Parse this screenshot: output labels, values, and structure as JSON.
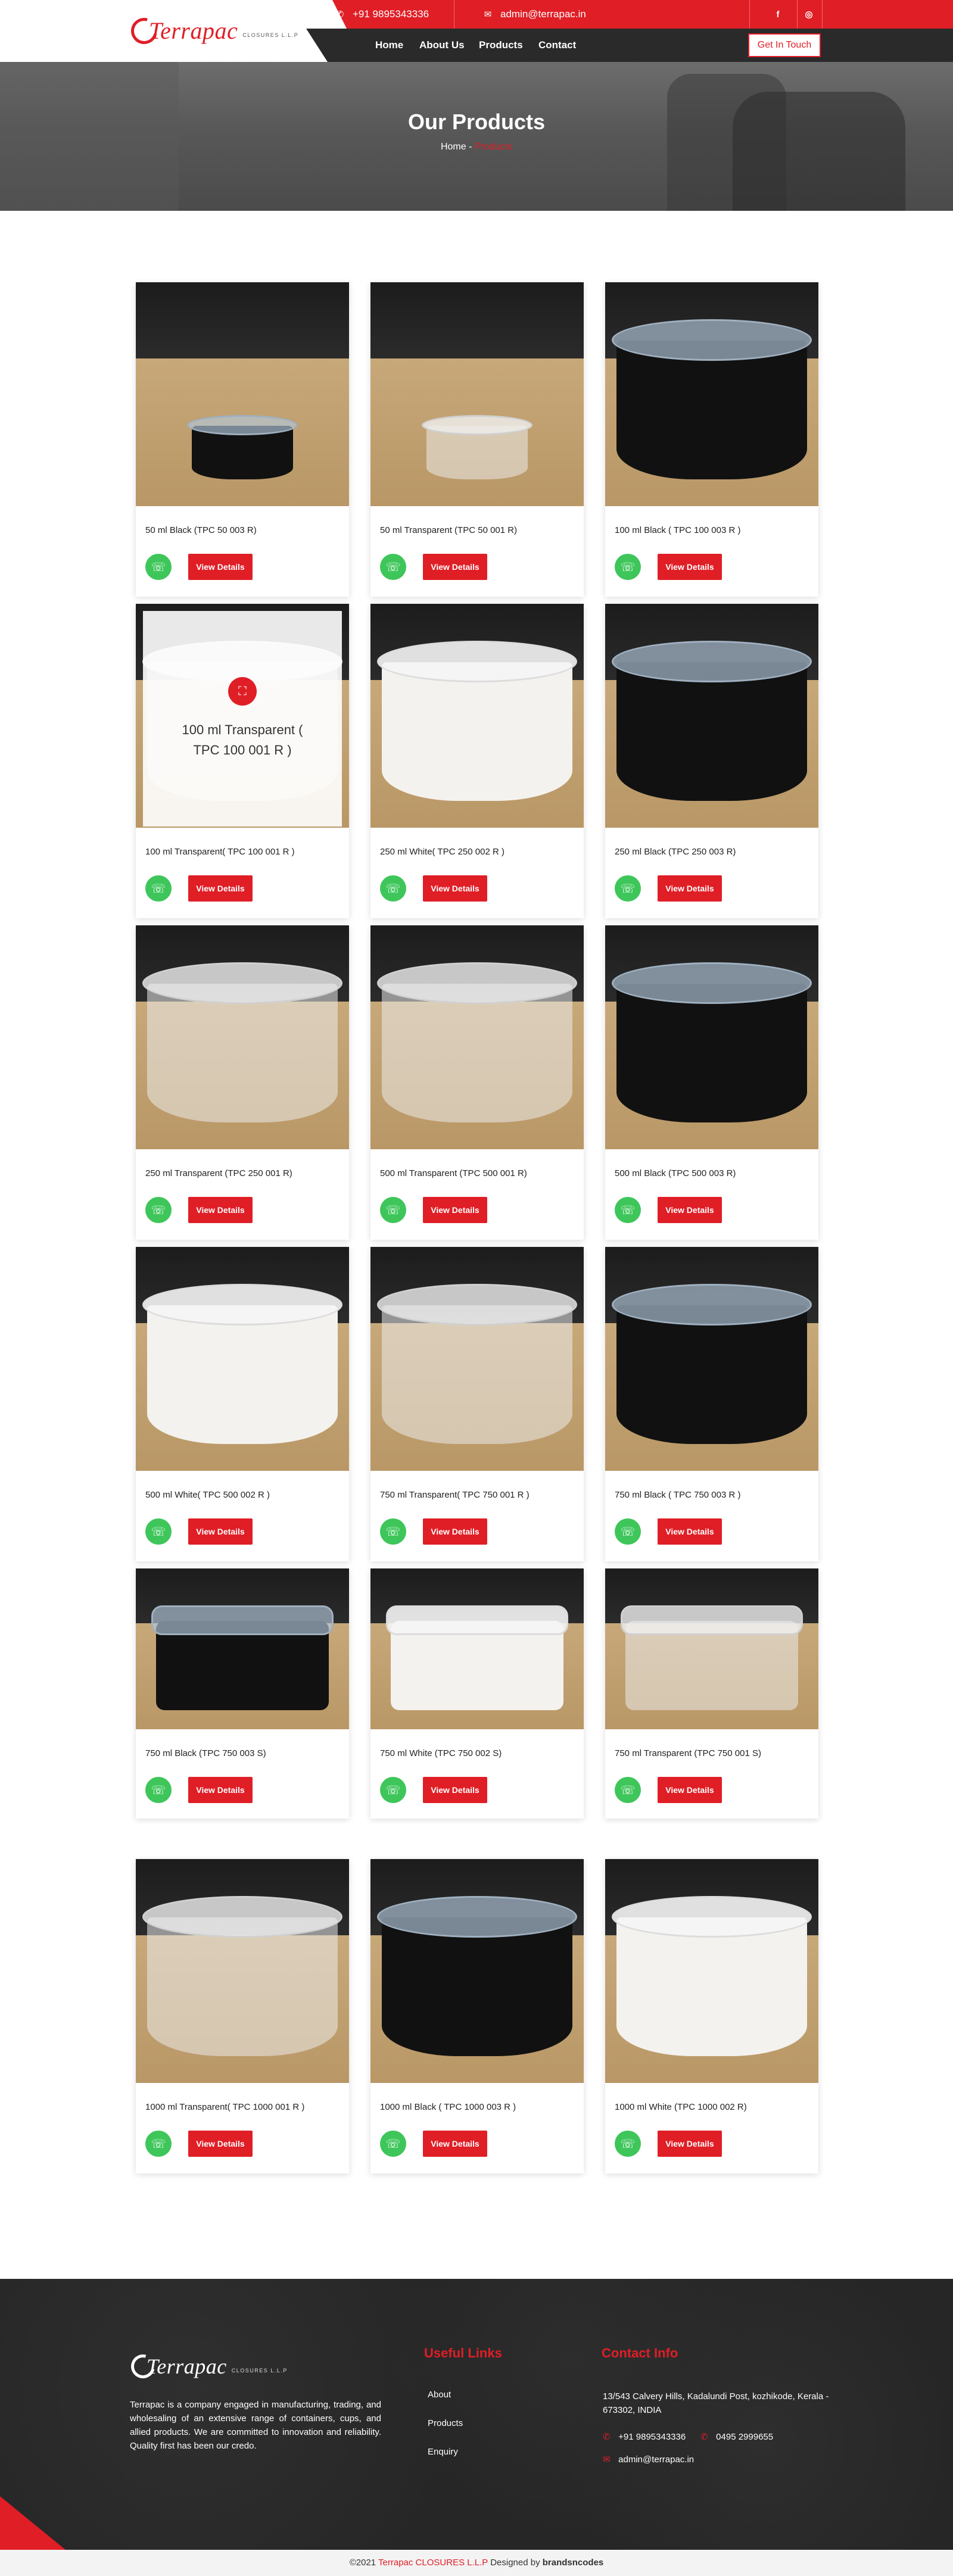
{
  "brand": {
    "name": "Terrapac",
    "sub": "CLOSURES L.L.P",
    "accent": "#e01e26"
  },
  "topbar": {
    "phone": "+91 9895343336",
    "email": "admin@terrapac.in",
    "social": [
      {
        "name": "facebook-icon",
        "glyph": "f"
      },
      {
        "name": "instagram-icon",
        "glyph": "◎"
      }
    ]
  },
  "nav": {
    "items": [
      "Home",
      "About Us",
      "Products",
      "Contact"
    ],
    "cta": "Get In Touch"
  },
  "hero": {
    "title": "Our Products",
    "crumb_home": "Home",
    "crumb_sep": "-",
    "crumb_current": "Products"
  },
  "products": [
    {
      "title": "50 ml Black (TPC 50 003 R)",
      "color": "black"
    },
    {
      "title": "50 ml Transparent (TPC 50 001 R)",
      "color": "clear"
    },
    {
      "title": "100 ml Black ( TPC 100 003 R )",
      "color": "black"
    },
    {
      "title": "100 ml Transparent( TPC 100 001 R )",
      "color": "clear"
    },
    {
      "title": "250 ml White( TPC 250 002 R )",
      "color": "white"
    },
    {
      "title": "250 ml Black (TPC 250 003 R)",
      "color": "black"
    },
    {
      "title": "250 ml Transparent (TPC 250 001 R)",
      "color": "clear"
    },
    {
      "title": "500 ml Transparent (TPC 500 001 R)",
      "color": "clear"
    },
    {
      "title": "500 ml Black (TPC 500 003 R)",
      "color": "black"
    },
    {
      "title": "500 ml White( TPC 500 002 R )",
      "color": "white"
    },
    {
      "title": "750 ml Transparent( TPC 750 001 R )",
      "color": "clear"
    },
    {
      "title": "750 ml Black ( TPC 750 003 R )",
      "color": "black"
    },
    {
      "title": "750 ml Black (TPC 750 003 S)",
      "color": "black"
    },
    {
      "title": "750 ml White (TPC 750 002 S)",
      "color": "white"
    },
    {
      "title": "750 ml Transparent (TPC 750 001 S)",
      "color": "clear"
    },
    {
      "title": "1000 ml Transparent( TPC 1000 001 R )",
      "color": "clear"
    },
    {
      "title": "1000 ml Black ( TPC 1000 003 R )",
      "color": "black"
    },
    {
      "title": "1000 ml White (TPC 1000 002 R)",
      "color": "white"
    }
  ],
  "overlay": {
    "text": "100 ml Transparent ( TPC 100 001 R )"
  },
  "buttons": {
    "view_details": "View Details"
  },
  "footer": {
    "about": "Terrapac is a company engaged in manufacturing, trading, and wholesaling of an extensive range of containers, cups, and allied products. We are committed to innovation and reliability. Quality first has been our credo.",
    "links_heading": "Useful Links",
    "links": [
      "About",
      "Products",
      "Enquiry"
    ],
    "contact_heading": "Contact Info",
    "address": "13/543 Calvery Hills, Kadalundi Post, kozhikode, Kerala - 673302, INDIA",
    "phone1": "+91 9895343336",
    "phone2": "0495 2999655",
    "email": "admin@terrapac.in"
  },
  "copyright": {
    "prefix": "©2021",
    "company": "Terrapac CLOSURES L.L.P",
    "designed": "Designed by",
    "designer": "brandsncodes"
  }
}
